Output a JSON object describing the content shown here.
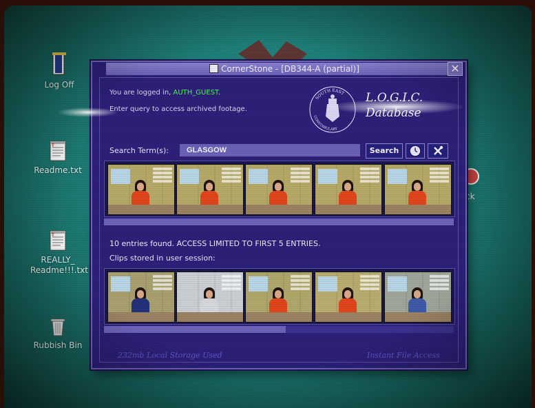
{
  "desktop": {
    "icons": [
      {
        "label_lines": [
          "Log Off"
        ],
        "icon": "exit-door-icon"
      },
      {
        "label_lines": [
          "Readme.txt"
        ],
        "icon": "text-file-icon"
      },
      {
        "label_lines": [
          "REALLY_",
          "Readme!!!.txt"
        ],
        "icon": "text-file-icon"
      },
      {
        "label_lines": [
          "Rubbish Bin"
        ],
        "icon": "trash-icon"
      }
    ],
    "partial_icon_label": "ck"
  },
  "window": {
    "title": "CornerStone - [DB344-A (partial)]",
    "close_glyph": "✕",
    "login_prefix": "You are logged in, ",
    "login_user": "AUTH_GUEST",
    "login_suffix": ".",
    "instruction": "Enter query to access archived footage.",
    "logo_line1": "L.O.G.I.C.",
    "logo_line2": "Database",
    "seal_text_top": "SOUTH EAST",
    "seal_text_bottom": "CONSTABULARY",
    "search": {
      "label": "Search Term(s):",
      "value": "GLASGOW",
      "button": "Search"
    },
    "results_progress": 1.0,
    "entries_text": "10 entries found. ACCESS LIMITED TO FIRST 5 ENTRIES.",
    "clips_label": "Clips stored in user session:",
    "storage_progress": 0.52,
    "footer_left": "232mb Local Storage Used",
    "footer_right": "Instant File Access"
  },
  "colors": {
    "username": "#44ff44",
    "window_bg": "#2c2079",
    "desktop": "#1f8079"
  }
}
